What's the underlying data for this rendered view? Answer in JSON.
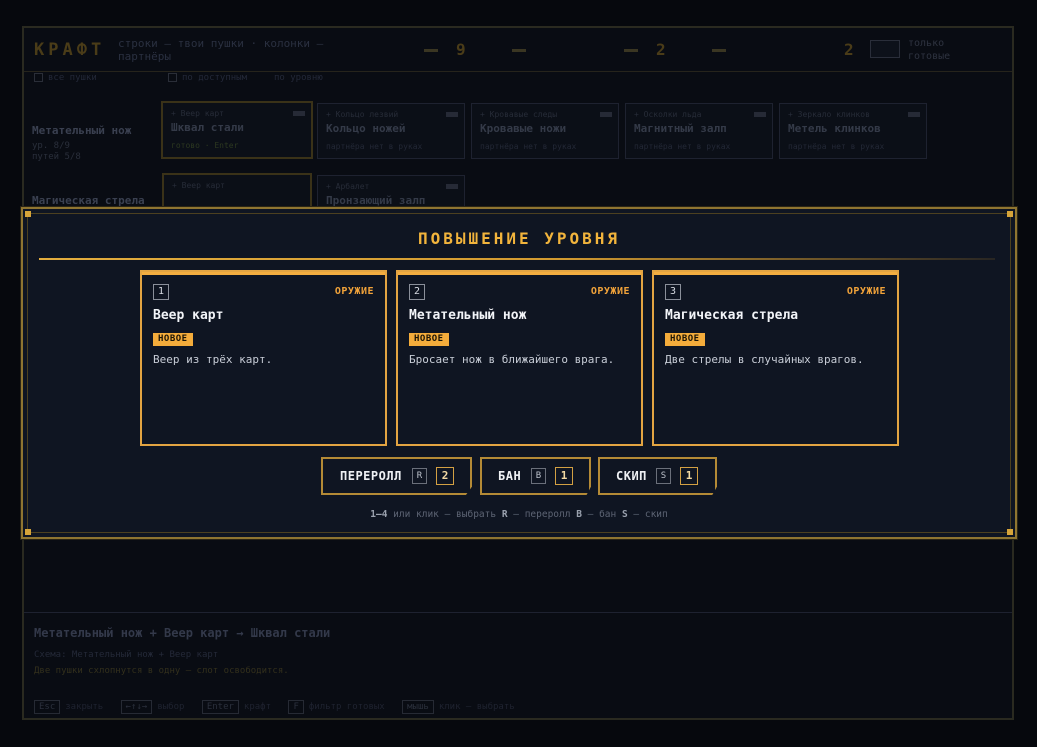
{
  "background": {
    "title": "КРАФТ",
    "subtitle": "строки — твои пушки · колонки — партнёры",
    "stats": [
      "9",
      "2",
      "2"
    ],
    "toggle_label": "только готовые",
    "filters": [
      "все пушки",
      "по доступным",
      "по уровню"
    ],
    "powers": [
      {
        "name": "Метательный нож",
        "meta1": "ур. 8/9",
        "meta2": "путей 5/8"
      },
      {
        "name": "Магическая стрела",
        "meta1": "",
        "meta2": ""
      }
    ],
    "cards": [
      {
        "tag": "+ Веер карт",
        "name": "Шквал стали",
        "sub": "готово · Enter",
        "ready": true
      },
      {
        "tag": "+ Кольцо лезвий",
        "name": "Кольцо ножей",
        "sub": "партнёра нет в руках",
        "ready": false
      },
      {
        "tag": "+ Кровавые следы",
        "name": "Кровавые ножи",
        "sub": "партнёра нет в руках",
        "ready": false
      },
      {
        "tag": "+ Осколки льда",
        "name": "Магнитный залп",
        "sub": "партнёра нет в руках",
        "ready": false
      },
      {
        "tag": "+ Зеркало клинков",
        "name": "Метель клинков",
        "sub": "партнёра нет в руках",
        "ready": false
      },
      {
        "tag": "+ Веер карт",
        "name": "",
        "sub": "",
        "ready": false
      },
      {
        "tag": "+ Арбалет",
        "name": "Пронзающий залп",
        "sub": "",
        "ready": false
      }
    ],
    "recipe": "Метательный нож + Веер карт → Шквал стали",
    "scheme": "Схема: Метательный нож + Веер карт",
    "note": "Две пушки схлопнутся в одну — слот освободится.",
    "keys": [
      {
        "key": "Esc",
        "desc": "закрыть"
      },
      {
        "key": "←↑↓→",
        "desc": "выбор"
      },
      {
        "key": "Enter",
        "desc": "крафт"
      },
      {
        "key": "F",
        "desc": "фильтр готовых"
      },
      {
        "key": "мышь",
        "desc": "клик — выбрать"
      }
    ]
  },
  "modal": {
    "title": "ПОВЫШЕНИЕ УРОВНЯ",
    "options": [
      {
        "num": "1",
        "type": "ОРУЖИЕ",
        "name": "Веер карт",
        "badge": "НОВОЕ",
        "desc": "Веер из трёх карт."
      },
      {
        "num": "2",
        "type": "ОРУЖИЕ",
        "name": "Метательный нож",
        "badge": "НОВОЕ",
        "desc": "Бросает нож в ближайшего врага."
      },
      {
        "num": "3",
        "type": "ОРУЖИЕ",
        "name": "Магическая стрела",
        "badge": "НОВОЕ",
        "desc": "Две стрелы в случайных врагов."
      }
    ],
    "actions": [
      {
        "label": "ПЕРЕРОЛЛ",
        "key": "R",
        "count": "2"
      },
      {
        "label": "БАН",
        "key": "B",
        "count": "1"
      },
      {
        "label": "СКИП",
        "key": "S",
        "count": "1"
      }
    ],
    "hint": {
      "k1": "1–4",
      "t1": " или клик — выбрать ",
      "k2": "R",
      "t2": " — переролл ",
      "k3": "B",
      "t3": " — бан ",
      "k4": "S",
      "t4": " — скип"
    }
  },
  "colors": {
    "accent": "#f2b43c",
    "card_border": "#e3a442",
    "badge": "#f4ac3b",
    "panel": "#0f1522",
    "backdrop": "#06080d"
  }
}
